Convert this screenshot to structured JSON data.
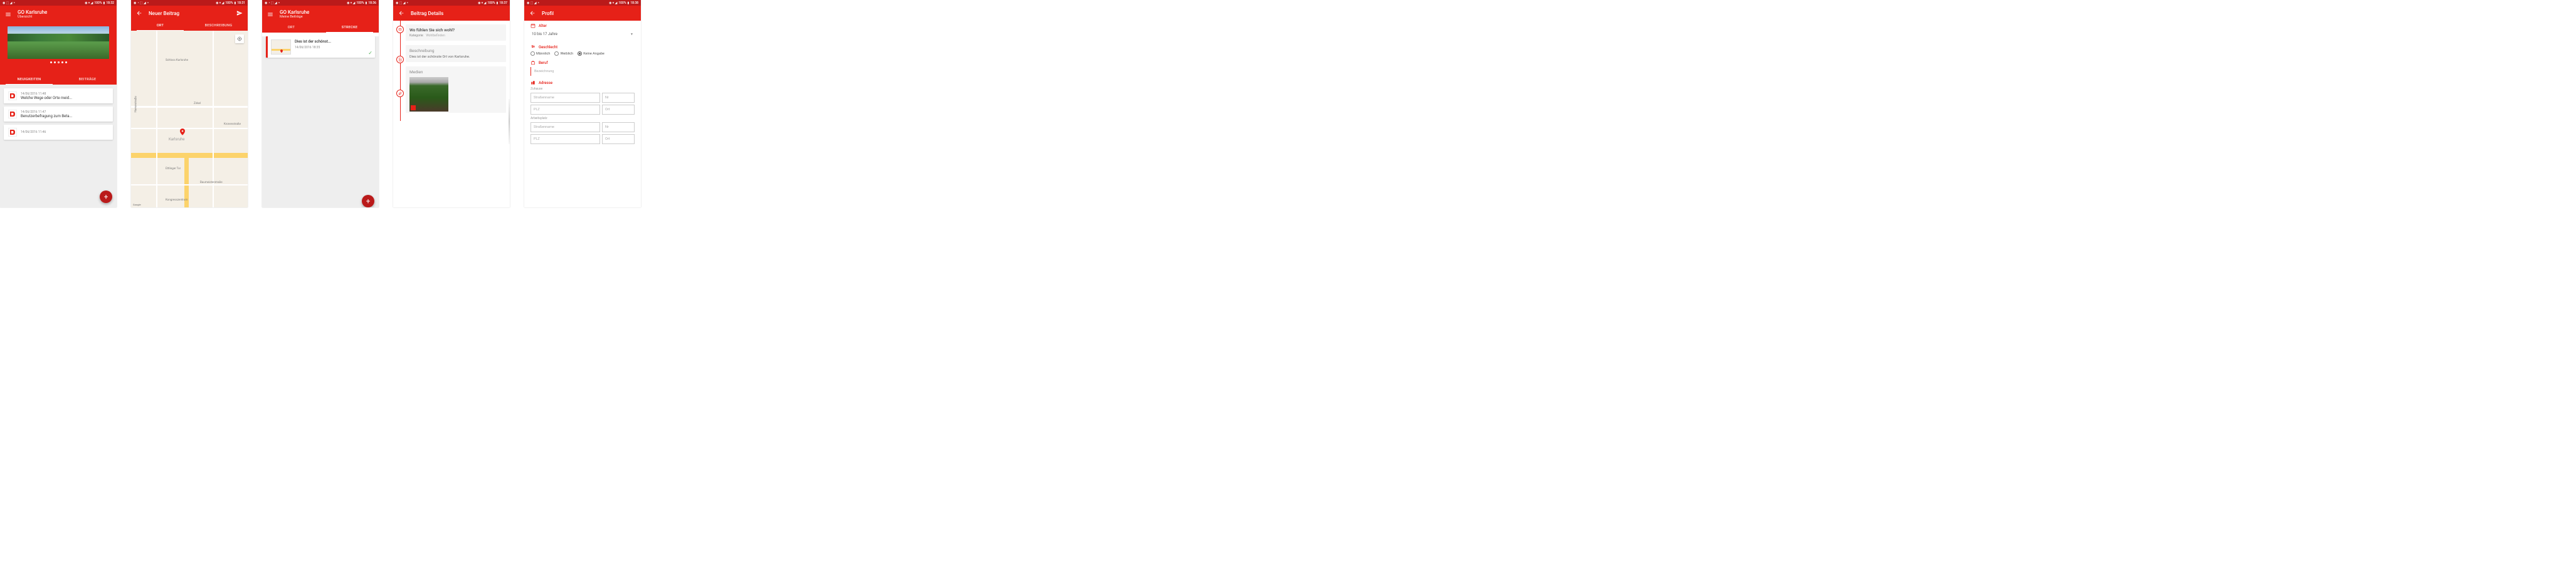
{
  "colors": {
    "primary": "#e62118",
    "primary_dark": "#ba1a1a",
    "fab": "#ba1a1a"
  },
  "screen1": {
    "status": {
      "battery": "100%",
      "time": "18:32"
    },
    "title": "GO Karlsruhe",
    "subtitle": "Übersicht",
    "tabs": [
      "NEUIGKEITEN",
      "BEITRÄGE"
    ],
    "active_tab": 0,
    "carousel_dots": 5,
    "carousel_active": 2,
    "items": [
      {
        "date": "14/06/2016  11:48",
        "title": "Welche Wege oder Orte meid..."
      },
      {
        "date": "14/06/2016  11:47",
        "title": "Benutzerbefragung zum Beta..."
      },
      {
        "date": "14/06/2016  11:46",
        "title": ""
      }
    ]
  },
  "screen2": {
    "status": {
      "battery": "100%",
      "time": "18:31"
    },
    "title": "Neuer Beitrag",
    "tabs": [
      "ORT",
      "BESCHREIBUNG"
    ],
    "active_tab": 0,
    "map_labels": {
      "city": "Karlsruhe",
      "castle": "Schloss Karlsruhe",
      "zirkel": "Zirkel",
      "herren": "Herrenstraße",
      "kronen": "Kronenstraße",
      "ettlinger": "Ettlinger Tor",
      "baumeister": "Baumeisterstraße",
      "kongress": "Kongresszentrum"
    },
    "google": "Google"
  },
  "screen3": {
    "status": {
      "battery": "100%",
      "time": "18:36"
    },
    "title": "GO Karlsruhe",
    "subtitle": "Meine Beiträge",
    "tabs": [
      "ORT",
      "STRECKE"
    ],
    "active_tab": 1,
    "item": {
      "title": "Dies ist der schönst...",
      "date": "14/06/2016  18:35"
    }
  },
  "screen4": {
    "status": {
      "battery": "100%",
      "time": "18:37"
    },
    "title": "Beitrag Details",
    "question": "Wo fühlen Sie sich wohl?",
    "category_label": "Kategorie:",
    "category_value": "Wohlbefinden",
    "desc_label": "Beschreibung",
    "desc_text": "Dies ist der schönste Ort von Karlsruhe.",
    "media_label": "Medien"
  },
  "screen5": {
    "status": {
      "battery": "100%",
      "time": "18:38"
    },
    "title": "Profil",
    "age_label": "Alter",
    "age_value": "10 bis 17 Jahre",
    "gender_label": "Geschlecht",
    "gender_options": [
      "Männlich",
      "Weiblich",
      "Keine Angabe"
    ],
    "gender_selected": 2,
    "job_label": "Beruf",
    "job_placeholder": "Bezeichnung",
    "address_label": "Adresse",
    "home_label": "Zuhause",
    "work_label": "Arbeitsplatz",
    "street_ph": "Straßenname",
    "nr_ph": "Nr",
    "plz_ph": "PLZ",
    "ort_ph": "Ort"
  }
}
